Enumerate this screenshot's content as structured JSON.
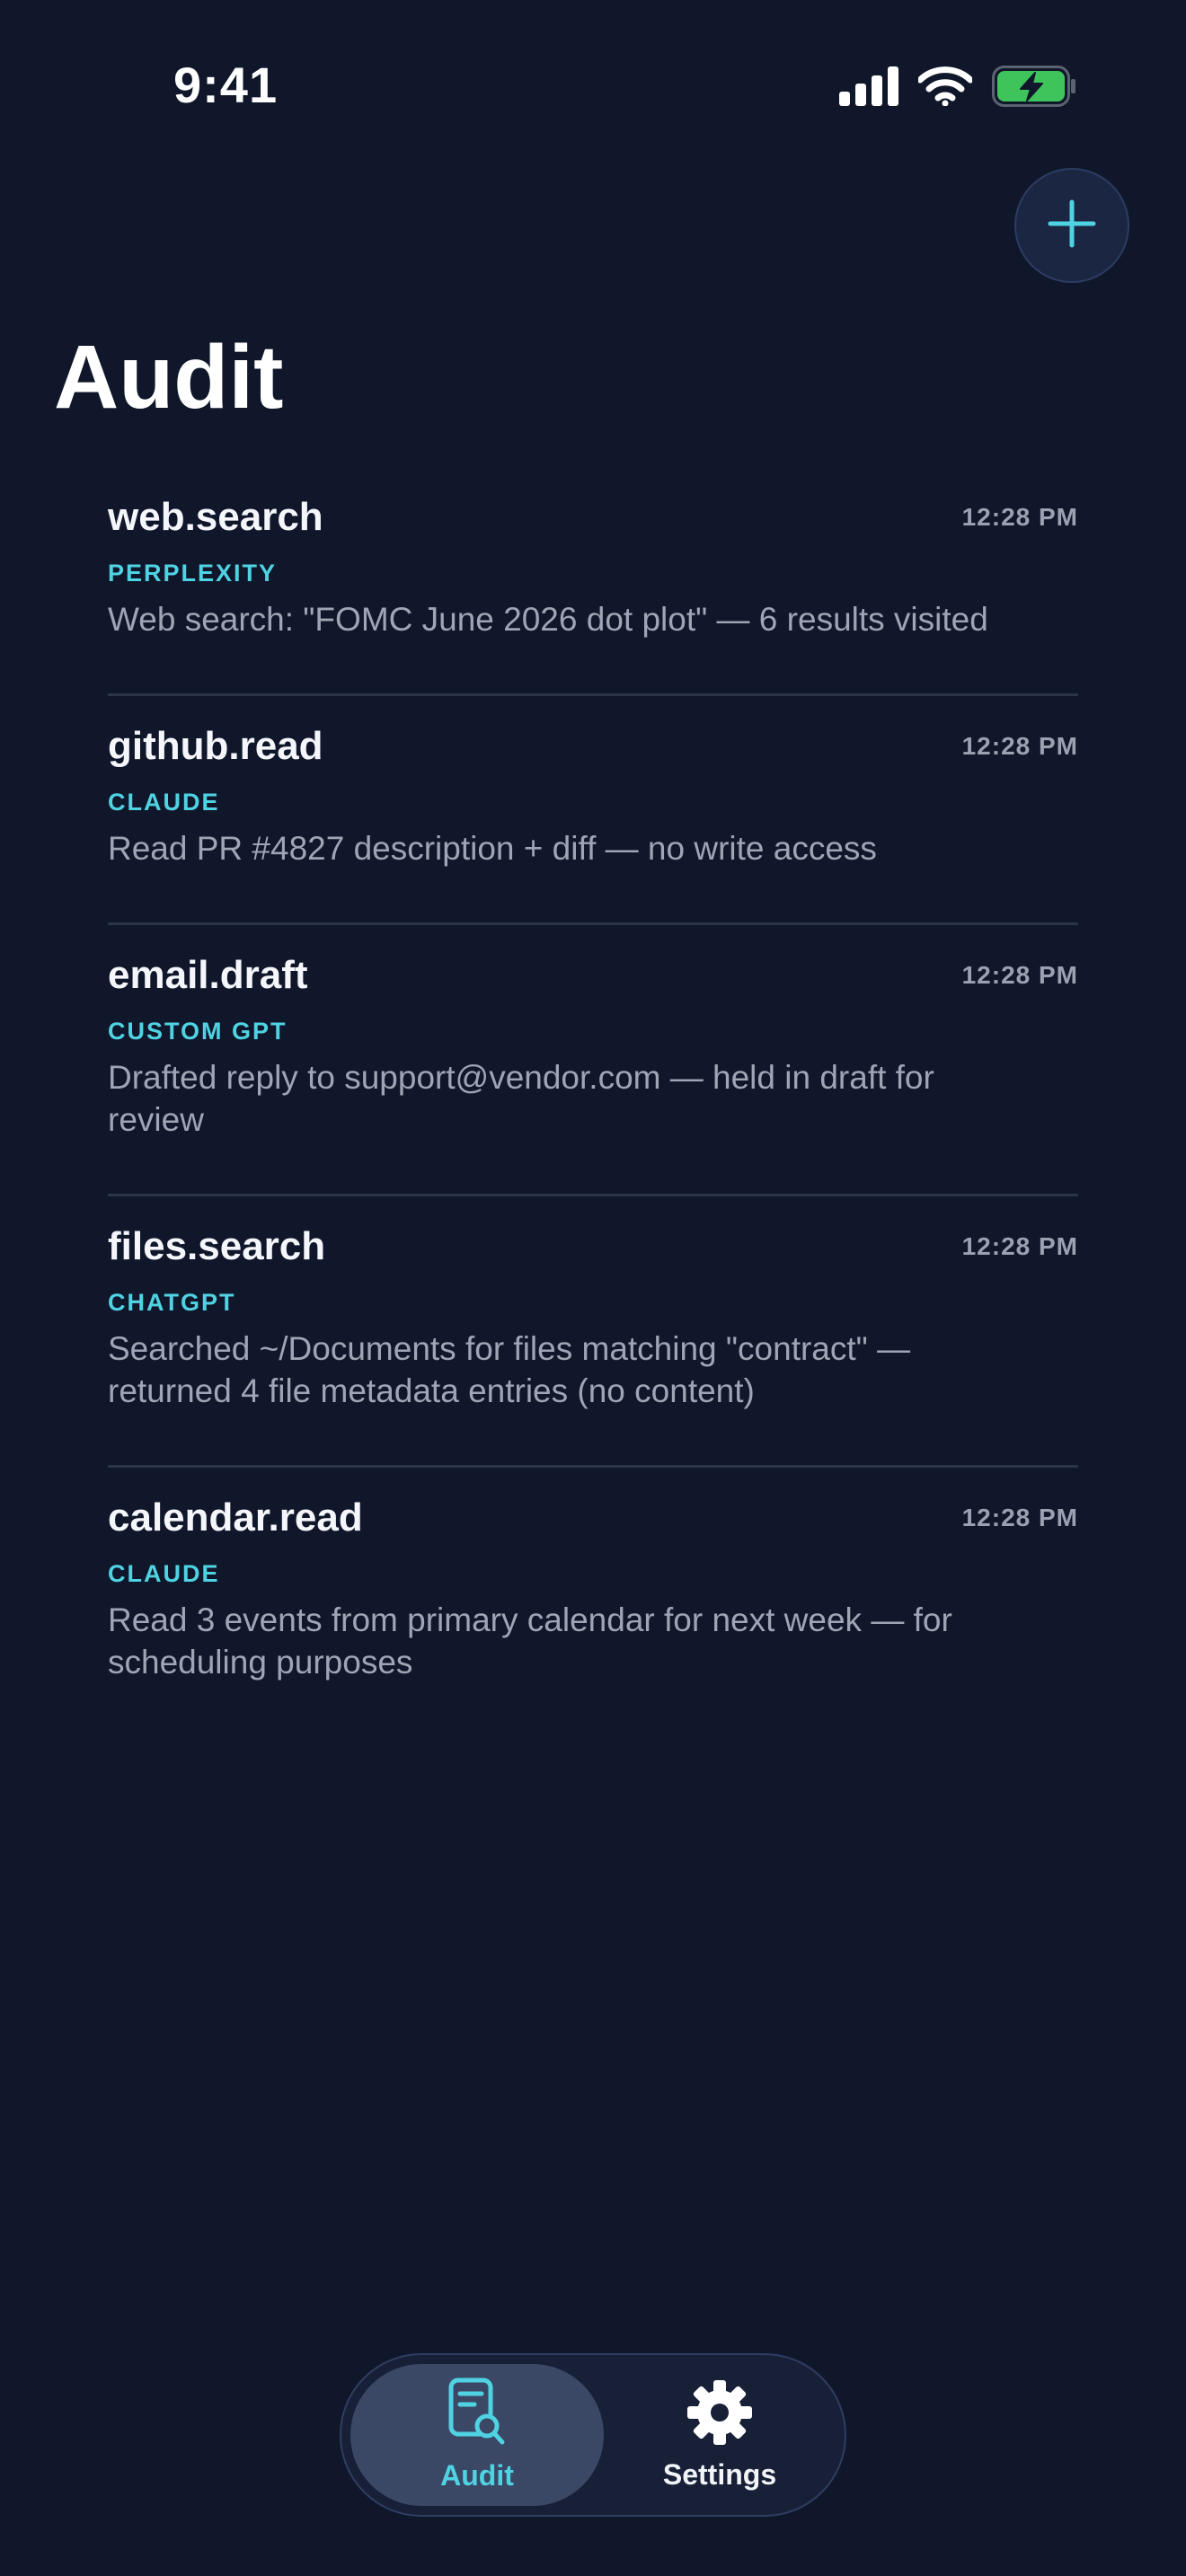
{
  "status_bar": {
    "time": "9:41",
    "icons": [
      "cellular-signal-icon",
      "wifi-icon",
      "battery-charging-icon"
    ]
  },
  "header": {
    "title": "Audit",
    "add_icon": "plus-icon"
  },
  "audit_entries": [
    {
      "tool": "web.search",
      "time": "12:28 PM",
      "source": "PERPLEXITY",
      "description": "Web search: \"FOMC June 2026 dot plot\" — 6 results visited"
    },
    {
      "tool": "github.read",
      "time": "12:28 PM",
      "source": "CLAUDE",
      "description": "Read PR #4827 description + diff — no write access"
    },
    {
      "tool": "email.draft",
      "time": "12:28 PM",
      "source": "CUSTOM GPT",
      "description": "Drafted reply to support@vendor.com — held in draft for review"
    },
    {
      "tool": "files.search",
      "time": "12:28 PM",
      "source": "CHATGPT",
      "description": "Searched ~/Documents for files matching \"contract\" — returned 4 file metadata entries (no content)"
    },
    {
      "tool": "calendar.read",
      "time": "12:28 PM",
      "source": "CLAUDE",
      "description": "Read 3 events from primary calendar for next week — for scheduling purposes"
    }
  ],
  "tab_bar": {
    "tabs": [
      {
        "label": "Audit",
        "icon": "document-search-icon",
        "selected": true
      },
      {
        "label": "Settings",
        "icon": "gear-icon",
        "selected": false
      }
    ]
  },
  "colors": {
    "background": "#10172a",
    "accent": "#4fd3e3",
    "battery_fill": "#3ec45a",
    "selected_tab": "#3b4865"
  }
}
